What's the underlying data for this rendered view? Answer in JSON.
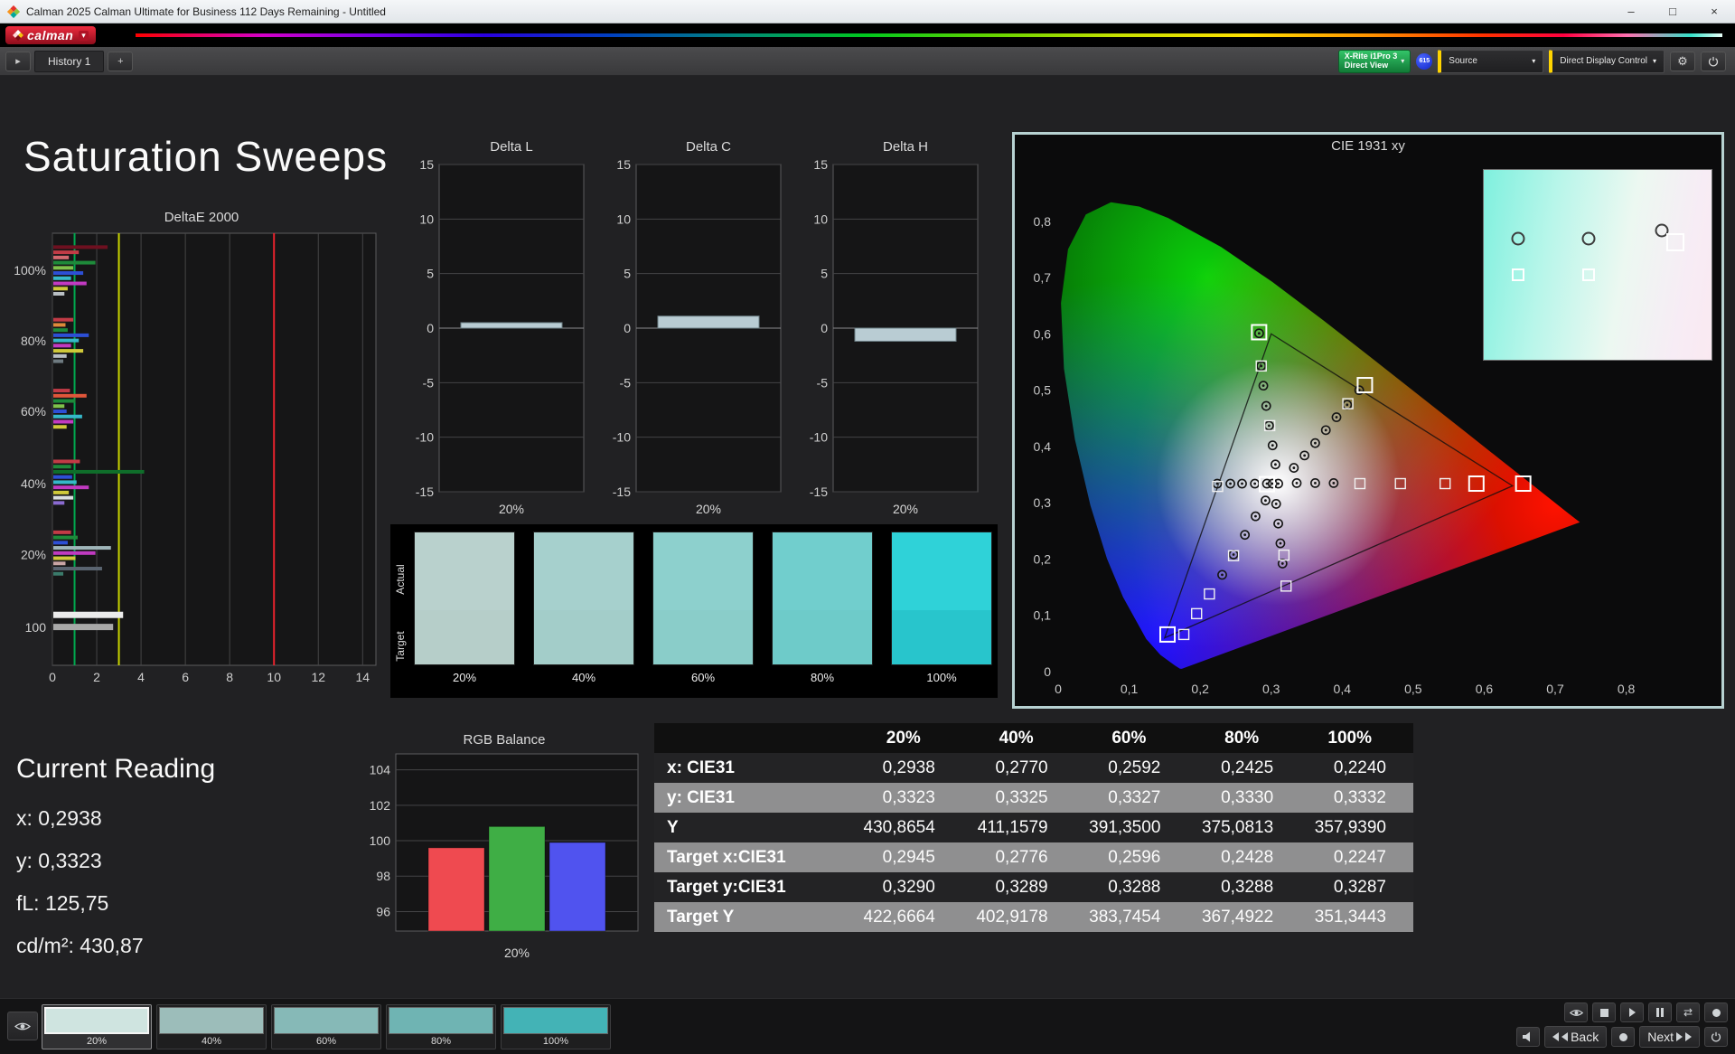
{
  "window": {
    "title": "Calman 2025 Calman Ultimate for Business 112 Days Remaining  - Untitled",
    "minimize": "–",
    "maximize": "□",
    "close": "×"
  },
  "brand": {
    "logo_text": "calman"
  },
  "toolbar": {
    "panel_toggle": "▸",
    "history_tab": "History 1",
    "add_tab": "+",
    "meter_line1": "X-Rite i1Pro 3",
    "meter_line2": "Direct View",
    "meter_badge": "615",
    "source_label": "Source",
    "display_label": "Direct Display Control"
  },
  "page": {
    "title": "Saturation Sweeps"
  },
  "deltae_chart": {
    "title": "DeltaE 2000",
    "xlim": 14.6,
    "x_ticks": [
      0,
      2,
      4,
      6,
      8,
      10,
      12,
      14
    ],
    "y_labels": [
      {
        "text": "100%",
        "f": 0.086
      },
      {
        "text": "80%",
        "f": 0.249
      },
      {
        "text": "60%",
        "f": 0.412
      },
      {
        "text": "40%",
        "f": 0.579
      },
      {
        "text": "20%",
        "f": 0.744
      },
      {
        "text": "100",
        "f": 0.912
      }
    ],
    "ref_lines": [
      {
        "v": 1,
        "color": "#00a94f"
      },
      {
        "v": 3,
        "color": "#c8d400"
      },
      {
        "v": 10,
        "color": "#e8232d"
      }
    ],
    "bars": [
      [
        0.028,
        "#6e1020",
        2.45
      ],
      [
        0.04,
        "#c23b46",
        1.15
      ],
      [
        0.052,
        "#d4696f",
        0.7
      ],
      [
        0.064,
        "#1e8a3a",
        1.9
      ],
      [
        0.076,
        "#7fc24b",
        0.9
      ],
      [
        0.088,
        "#2d4fd6",
        1.35
      ],
      [
        0.1,
        "#36b8c9",
        0.8
      ],
      [
        0.112,
        "#c23ac2",
        1.5
      ],
      [
        0.124,
        "#cfc93a",
        0.65
      ],
      [
        0.136,
        "#b9bfc4",
        0.5
      ],
      [
        0.196,
        "#c23b46",
        0.9
      ],
      [
        0.208,
        "#e08a3a",
        0.55
      ],
      [
        0.22,
        "#1e8a3a",
        0.65
      ],
      [
        0.232,
        "#2d4fd6",
        1.6
      ],
      [
        0.244,
        "#36b8c9",
        1.15
      ],
      [
        0.256,
        "#c23ac2",
        0.8
      ],
      [
        0.268,
        "#cfc93a",
        1.35
      ],
      [
        0.28,
        "#b9bfc4",
        0.6
      ],
      [
        0.292,
        "#6e7a80",
        0.45
      ],
      [
        0.36,
        "#c23b46",
        0.75
      ],
      [
        0.372,
        "#e0563a",
        1.5
      ],
      [
        0.384,
        "#1e8a3a",
        1.0
      ],
      [
        0.396,
        "#7fc24b",
        0.5
      ],
      [
        0.408,
        "#2d4fd6",
        0.6
      ],
      [
        0.42,
        "#36b8c9",
        1.3
      ],
      [
        0.432,
        "#c23ac2",
        0.9
      ],
      [
        0.444,
        "#cfc93a",
        0.6
      ],
      [
        0.524,
        "#c23b46",
        1.2
      ],
      [
        0.536,
        "#1e8a3a",
        0.8
      ],
      [
        0.548,
        "#0f6e2a",
        4.1
      ],
      [
        0.56,
        "#2d4fd6",
        0.85
      ],
      [
        0.572,
        "#36b8c9",
        1.05
      ],
      [
        0.584,
        "#c03ac0",
        1.6
      ],
      [
        0.596,
        "#cfc93a",
        0.7
      ],
      [
        0.608,
        "#d9dde0",
        0.9
      ],
      [
        0.62,
        "#8a6ad0",
        0.5
      ],
      [
        0.688,
        "#c23b46",
        0.8
      ],
      [
        0.7,
        "#1e8a3a",
        1.1
      ],
      [
        0.712,
        "#2d4fd6",
        0.65
      ],
      [
        0.724,
        "#9fb5b9",
        2.6
      ],
      [
        0.736,
        "#c03ac0",
        1.9
      ],
      [
        0.748,
        "#cfc93a",
        1.0
      ],
      [
        0.76,
        "#c9a5a5",
        0.55
      ],
      [
        0.772,
        "#5a6470",
        2.2
      ],
      [
        0.784,
        "#3a7a6a",
        0.45
      ],
      [
        0.876,
        "#ececec",
        3.15,
        7
      ],
      [
        0.904,
        "#a8a8a8",
        2.7,
        7
      ]
    ]
  },
  "delta_common": {
    "x_label": "20%",
    "ticks": [
      15,
      10,
      5,
      0,
      -5,
      -10,
      -15
    ],
    "lim": 15,
    "bar_color": "#b9ccd3"
  },
  "delta_l": {
    "title": "Delta L",
    "value": 0.5
  },
  "delta_c": {
    "title": "Delta C",
    "value": 1.1
  },
  "delta_h": {
    "title": "Delta H",
    "value": -1.2
  },
  "swatch_strip": {
    "actual_label": "Actual",
    "target_label": "Target",
    "items": [
      {
        "label": "20%",
        "actual": "#b9d1cd",
        "target": "#b6cec9"
      },
      {
        "label": "40%",
        "actual": "#a6d0cd",
        "target": "#a3cdc9"
      },
      {
        "label": "60%",
        "actual": "#8dd0cd",
        "target": "#8acdc9"
      },
      {
        "label": "80%",
        "actual": "#71cecd",
        "target": "#6ecbc9"
      },
      {
        "label": "100%",
        "actual": "#2fd2d8",
        "target": "#28c5cc"
      }
    ]
  },
  "cie": {
    "title": "CIE 1931 xy",
    "x_ticks": [
      {
        "v": 0,
        "t": "0"
      },
      {
        "v": 0.1,
        "t": "0,1"
      },
      {
        "v": 0.2,
        "t": "0,2"
      },
      {
        "v": 0.3,
        "t": "0,3"
      },
      {
        "v": 0.4,
        "t": "0,4"
      },
      {
        "v": 0.5,
        "t": "0,5"
      },
      {
        "v": 0.6,
        "t": "0,6"
      },
      {
        "v": 0.7,
        "t": "0,7"
      },
      {
        "v": 0.8,
        "t": "0,8"
      }
    ],
    "y_ticks": [
      {
        "v": 0.8,
        "t": "0,8"
      },
      {
        "v": 0.7,
        "t": "0,7"
      },
      {
        "v": 0.6,
        "t": "0,6"
      },
      {
        "v": 0.5,
        "t": "0,5"
      },
      {
        "v": 0.4,
        "t": "0,4"
      },
      {
        "v": 0.3,
        "t": "0,3"
      },
      {
        "v": 0.2,
        "t": "0,2"
      },
      {
        "v": 0.1,
        "t": "0,1"
      },
      {
        "v": 0,
        "t": "0"
      }
    ],
    "locus": [
      [
        0.1741,
        0.005
      ],
      [
        0.1714,
        0.0051
      ],
      [
        0.1644,
        0.0109
      ],
      [
        0.144,
        0.0297
      ],
      [
        0.1241,
        0.0578
      ],
      [
        0.0913,
        0.1327
      ],
      [
        0.0687,
        0.2007
      ],
      [
        0.0454,
        0.295
      ],
      [
        0.0235,
        0.4127
      ],
      [
        0.0082,
        0.5384
      ],
      [
        0.0039,
        0.6548
      ],
      [
        0.0139,
        0.7502
      ],
      [
        0.0389,
        0.812
      ],
      [
        0.0743,
        0.8338
      ],
      [
        0.1142,
        0.8262
      ],
      [
        0.1547,
        0.8059
      ],
      [
        0.2296,
        0.7543
      ],
      [
        0.3016,
        0.6923
      ],
      [
        0.3731,
        0.6245
      ],
      [
        0.4441,
        0.5547
      ],
      [
        0.5125,
        0.4866
      ],
      [
        0.5752,
        0.4242
      ],
      [
        0.627,
        0.3725
      ],
      [
        0.6658,
        0.334
      ],
      [
        0.6915,
        0.3083
      ],
      [
        0.719,
        0.2809
      ],
      [
        0.7347,
        0.2653
      ]
    ],
    "triangle": [
      [
        0.64,
        0.33
      ],
      [
        0.3,
        0.6
      ],
      [
        0.15,
        0.06
      ]
    ],
    "circles": [
      [
        0.294,
        0.334
      ],
      [
        0.277,
        0.334
      ],
      [
        0.259,
        0.334
      ],
      [
        0.2425,
        0.334
      ],
      [
        0.224,
        0.334
      ],
      [
        0.302,
        0.334
      ],
      [
        0.31,
        0.334
      ],
      [
        0.306,
        0.368
      ],
      [
        0.302,
        0.402
      ],
      [
        0.297,
        0.437
      ],
      [
        0.293,
        0.472
      ],
      [
        0.289,
        0.508
      ],
      [
        0.286,
        0.543
      ],
      [
        0.283,
        0.601
      ],
      [
        0.332,
        0.362
      ],
      [
        0.347,
        0.384
      ],
      [
        0.362,
        0.406
      ],
      [
        0.377,
        0.429
      ],
      [
        0.392,
        0.452
      ],
      [
        0.407,
        0.474
      ],
      [
        0.424,
        0.5
      ],
      [
        0.336,
        0.335
      ],
      [
        0.362,
        0.335
      ],
      [
        0.388,
        0.335
      ],
      [
        0.292,
        0.304
      ],
      [
        0.278,
        0.276
      ],
      [
        0.263,
        0.243
      ],
      [
        0.247,
        0.208
      ],
      [
        0.231,
        0.172
      ],
      [
        0.307,
        0.298
      ],
      [
        0.31,
        0.263
      ],
      [
        0.313,
        0.228
      ],
      [
        0.316,
        0.192
      ]
    ],
    "squares": [
      [
        0.425,
        0.334
      ],
      [
        0.482,
        0.334
      ],
      [
        0.545,
        0.334
      ],
      [
        0.2247,
        0.329
      ],
      [
        0.298,
        0.437
      ],
      [
        0.286,
        0.543
      ],
      [
        0.408,
        0.476
      ],
      [
        0.247,
        0.206
      ],
      [
        0.213,
        0.138
      ],
      [
        0.195,
        0.103
      ],
      [
        0.177,
        0.066
      ],
      [
        0.318,
        0.207
      ],
      [
        0.321,
        0.152
      ]
    ],
    "big_squares": [
      [
        0.655,
        0.334
      ],
      [
        0.589,
        0.334
      ],
      [
        0.154,
        0.066
      ],
      [
        0.283,
        0.603
      ],
      [
        0.432,
        0.509
      ],
      [
        0.294,
        0.333
      ]
    ],
    "inset": {
      "circles": [
        [
          15,
          36
        ],
        [
          46,
          36
        ],
        [
          78,
          32
        ]
      ],
      "squares": [
        [
          15,
          55
        ],
        [
          46,
          55
        ]
      ],
      "big": [
        [
          84,
          38
        ]
      ]
    }
  },
  "current_reading": {
    "title": "Current Reading",
    "lines": [
      "x: 0,2938",
      "y: 0,3323",
      "fL: 125,75",
      "cd/m²: 430,87"
    ]
  },
  "rgb_balance": {
    "title": "RGB Balance",
    "x_label": "20%",
    "ylim": [
      94.9,
      104.9
    ],
    "ticks": [
      104,
      102,
      100,
      98,
      96
    ],
    "bars": [
      {
        "color": "#ef4a50",
        "value": 99.6
      },
      {
        "color": "#3fae45",
        "value": 100.8
      },
      {
        "color": "#5053ef",
        "value": 99.9
      }
    ]
  },
  "table": {
    "headers": [
      "",
      "20%",
      "40%",
      "60%",
      "80%",
      "100%"
    ],
    "rows": [
      {
        "label": "x: CIE31",
        "values": [
          "0,2938",
          "0,2770",
          "0,2592",
          "0,2425",
          "0,2240"
        ]
      },
      {
        "label": "y: CIE31",
        "values": [
          "0,3323",
          "0,3325",
          "0,3327",
          "0,3330",
          "0,3332"
        ]
      },
      {
        "label": "Y",
        "values": [
          "430,8654",
          "411,1579",
          "391,3500",
          "375,0813",
          "357,9390"
        ]
      },
      {
        "label": "Target x:CIE31",
        "values": [
          "0,2945",
          "0,2776",
          "0,2596",
          "0,2428",
          "0,2247"
        ]
      },
      {
        "label": "Target y:CIE31",
        "values": [
          "0,3290",
          "0,3289",
          "0,3288",
          "0,3288",
          "0,3287"
        ]
      },
      {
        "label": "Target Y",
        "values": [
          "422,6664",
          "402,9178",
          "383,7454",
          "367,4922",
          "351,3443"
        ]
      }
    ]
  },
  "bottom_bar": {
    "swatches": [
      {
        "label": "20%",
        "color": "#cfe4e0",
        "selected": true
      },
      {
        "label": "40%",
        "color": "#b7dedb",
        "selected": false
      },
      {
        "label": "60%",
        "color": "#9edad7",
        "selected": false
      },
      {
        "label": "80%",
        "color": "#82d4d3",
        "selected": false
      },
      {
        "label": "100%",
        "color": "#4fd2d6",
        "selected": false
      }
    ],
    "back_label": "Back",
    "next_label": "Next"
  }
}
